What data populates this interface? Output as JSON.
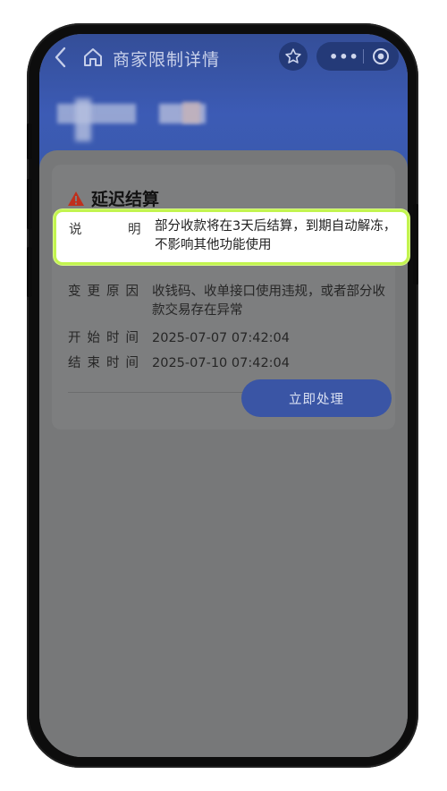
{
  "nav": {
    "title": "商家限制详情"
  },
  "card": {
    "heading": "延迟结算",
    "rows": [
      {
        "label": "说明",
        "label_left": "说",
        "label_right": "明",
        "value": "部分收款将在3天后结算，到期自动解冻，不影响其他功能使用"
      },
      {
        "label": "变更原因",
        "value": "收钱码、收单接口使用违规，或者部分收款交易存在异常"
      },
      {
        "label": "开始时间",
        "value": "2025-07-07 07:42:04"
      },
      {
        "label": "结束时间",
        "value": "2025-07-10 07:42:04"
      }
    ],
    "action_label": "立即处理"
  },
  "colors": {
    "header_blue": "#3c5bb5",
    "button_blue": "#3a55a5",
    "alert_red": "#c0301c",
    "highlight_border": "#c2f44f"
  },
  "icons": [
    "back-arrow-icon",
    "home-icon",
    "star-icon",
    "more-dots-icon",
    "target-icon",
    "warning-icon"
  ]
}
